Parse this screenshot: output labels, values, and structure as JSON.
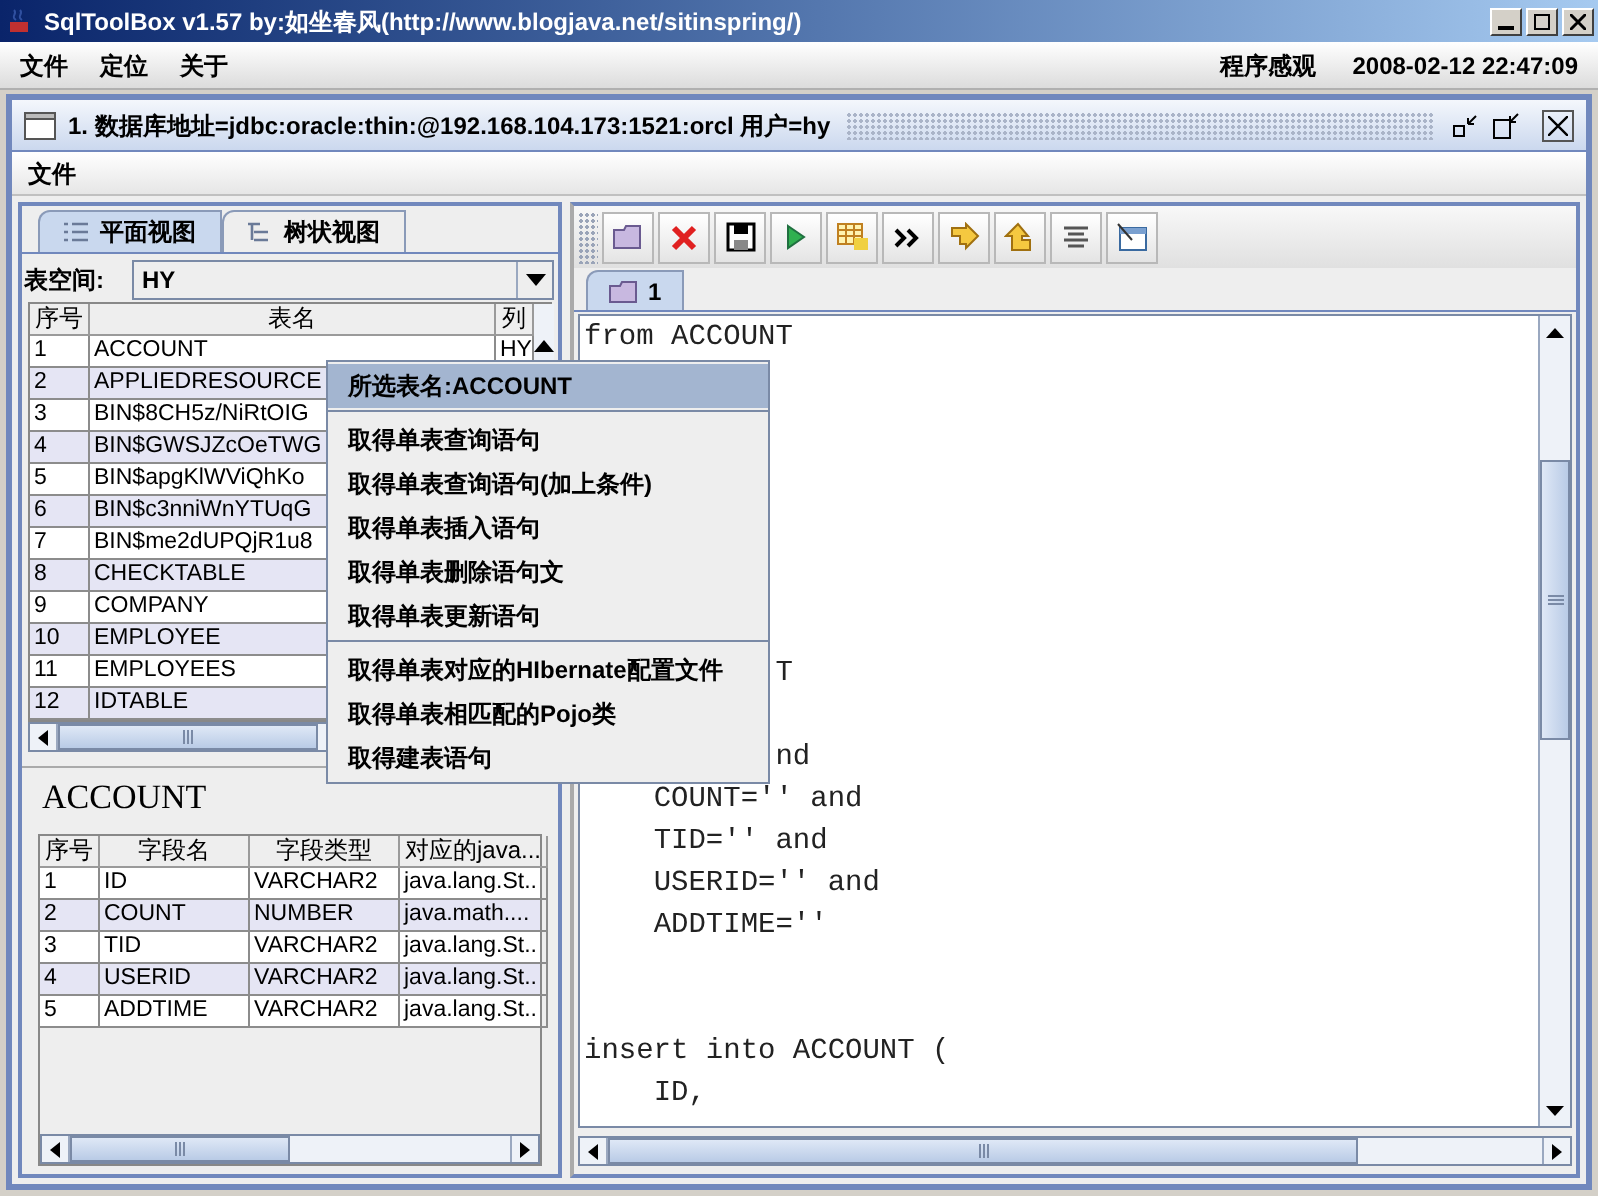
{
  "window": {
    "title": "SqlToolBox v1.57 by:如坐春风(http://www.blogjava.net/sitinspring/)"
  },
  "menu": [
    "文件",
    "定位",
    "关于"
  ],
  "menu_right": {
    "look_and_feel": "程序感观",
    "datetime": "2008-02-12 22:47:09"
  },
  "inner_window": {
    "title": "1. 数据库地址=jdbc:oracle:thin:@192.168.104.173:1521:orcl 用户=hy",
    "menu": [
      "文件"
    ]
  },
  "left_tabs": [
    {
      "label": "平面视图",
      "selected": true
    },
    {
      "label": "树状视图",
      "selected": false
    }
  ],
  "tablespace": {
    "label": "表空间:",
    "value": "HY"
  },
  "tables": {
    "columns": [
      "序号",
      "表名",
      "列"
    ],
    "rows": [
      [
        "1",
        "ACCOUNT",
        "HY"
      ],
      [
        "2",
        "APPLIEDRESOURCE"
      ],
      [
        "3",
        "BIN$8CH5z/NiRtOIG"
      ],
      [
        "4",
        "BIN$GWSJZcOeTWG"
      ],
      [
        "5",
        "BIN$apgKlWViQhKo"
      ],
      [
        "6",
        "BIN$c3nniWnYTUqG"
      ],
      [
        "7",
        "BIN$me2dUPQjR1u8"
      ],
      [
        "8",
        "CHECKTABLE"
      ],
      [
        "9",
        "COMPANY"
      ],
      [
        "10",
        "EMPLOYEE"
      ],
      [
        "11",
        "EMPLOYEES"
      ],
      [
        "12",
        "IDTABLE"
      ]
    ]
  },
  "selected_table": "ACCOUNT",
  "fields": {
    "columns": [
      "序号",
      "字段名",
      "字段类型",
      "对应的java..."
    ],
    "rows": [
      [
        "1",
        "ID",
        "VARCHAR2",
        "java.lang.St.."
      ],
      [
        "2",
        "COUNT",
        "NUMBER",
        "java.math...."
      ],
      [
        "3",
        "TID",
        "VARCHAR2",
        "java.lang.St.."
      ],
      [
        "4",
        "USERID",
        "VARCHAR2",
        "java.lang.St.."
      ],
      [
        "5",
        "ADDTIME",
        "VARCHAR2",
        "java.lang.St.."
      ]
    ]
  },
  "editor_tab": {
    "label": "1",
    "selected": true
  },
  "editor_lines": [
    {
      "kind": "text",
      "text": "from ACCOUNT"
    },
    {
      "kind": "blank"
    },
    {
      "kind": "blank"
    },
    {
      "kind": "blank"
    },
    {
      "kind": "blank"
    },
    {
      "kind": "blank"
    },
    {
      "kind": "blank"
    },
    {
      "kind": "blank"
    },
    {
      "kind": "text",
      "text": "           T"
    },
    {
      "kind": "blank"
    },
    {
      "kind": "text",
      "text": "           nd"
    },
    {
      "kind": "text",
      "text": "    COUNT='' and"
    },
    {
      "kind": "text",
      "text": "    TID='' and"
    },
    {
      "kind": "text",
      "text": "    USERID='' and"
    },
    {
      "kind": "text",
      "text": "    ADDTIME=''"
    },
    {
      "kind": "blank"
    },
    {
      "kind": "blank"
    },
    {
      "kind": "text",
      "text": "insert into ACCOUNT ("
    },
    {
      "kind": "text",
      "text": "    ID,"
    }
  ],
  "context_menu": [
    {
      "label": "所选表名:ACCOUNT",
      "selected": true,
      "separator_before": false
    },
    {
      "label": "取得单表查询语句",
      "selected": false,
      "separator_before": true
    },
    {
      "label": "取得单表查询语句(加上条件)",
      "selected": false,
      "separator_before": false
    },
    {
      "label": "取得单表插入语句",
      "selected": false,
      "separator_before": false
    },
    {
      "label": "取得单表删除语句文",
      "selected": false,
      "separator_before": false
    },
    {
      "label": "取得单表更新语句",
      "selected": false,
      "separator_before": false
    },
    {
      "label": "取得单表对应的HIbernate配置文件",
      "selected": false,
      "separator_before": true
    },
    {
      "label": "取得单表相匹配的Pojo类",
      "selected": false,
      "separator_before": false
    },
    {
      "label": "取得建表语句",
      "selected": false,
      "separator_before": false
    }
  ]
}
